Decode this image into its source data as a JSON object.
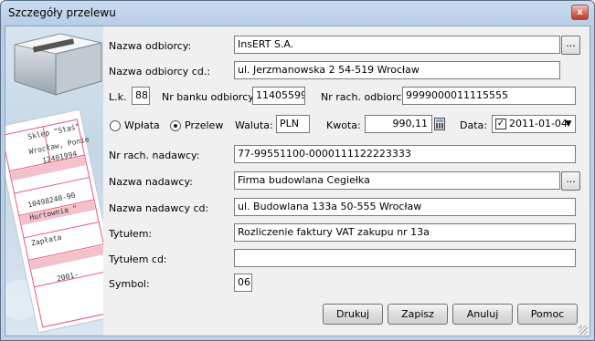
{
  "window": {
    "title": "Szczegóły przelewu",
    "close_glyph": "x"
  },
  "labels": {
    "nazwa_odbiorcy": "Nazwa odbiorcy:",
    "nazwa_odbiorcy_cd": "Nazwa odbiorcy cd.:",
    "lk": "L.k.",
    "nr_banku_odbiorcy": "Nr banku odbiorcy:",
    "nr_rach_odbiorcy": "Nr rach. odbiorcy:",
    "wplata": "Wpłata",
    "przelew": "Przelew",
    "waluta": "Waluta:",
    "kwota": "Kwota:",
    "data": "Data:",
    "nr_rach_nadawcy": "Nr rach. nadawcy:",
    "nazwa_nadawcy": "Nazwa nadawcy:",
    "nazwa_nadawcy_cd": "Nazwa nadawcy cd:",
    "tytulem": "Tytułem:",
    "tytulem_cd": "Tytułem cd:",
    "symbol": "Symbol:"
  },
  "values": {
    "nazwa_odbiorcy": "InsERT S.A.",
    "nazwa_odbiorcy_cd": "ul. Jerzmanowska 2 54-519 Wrocław",
    "lk": "88",
    "nr_banku_odbiorcy": "11405599",
    "nr_rach_odbiorcy": "9999000011115555",
    "waluta": "PLN",
    "kwota": "990,11",
    "data": "2011-01-04",
    "data_checked": true,
    "rodzaj_selected": "przelew",
    "nr_rach_nadawcy": "77-99551100-0000111122223333",
    "nazwa_nadawcy": "Firma budowlana Cegiełka",
    "nazwa_nadawcy_cd": "ul. Budowlana 133a 50-555 Wrocław",
    "tytulem": "Rozliczenie faktury VAT zakupu nr 13a",
    "tytulem_cd": "",
    "symbol": "06"
  },
  "buttons": {
    "browse": "...",
    "drukuj": "Drukuj",
    "zapisz": "Zapisz",
    "anuluj": "Anuluj",
    "pomoc": "Pomoc"
  },
  "receipt_lines": [
    "Sklep \"Staś\"",
    "Wrocław, Ponie",
    "12401994",
    "10498240-90",
    "Hurtownia \"",
    "Zapłata",
    "2001-"
  ],
  "icons": [
    "printer-icon",
    "calculator-icon",
    "dropdown-arrow-icon",
    "close-icon"
  ]
}
